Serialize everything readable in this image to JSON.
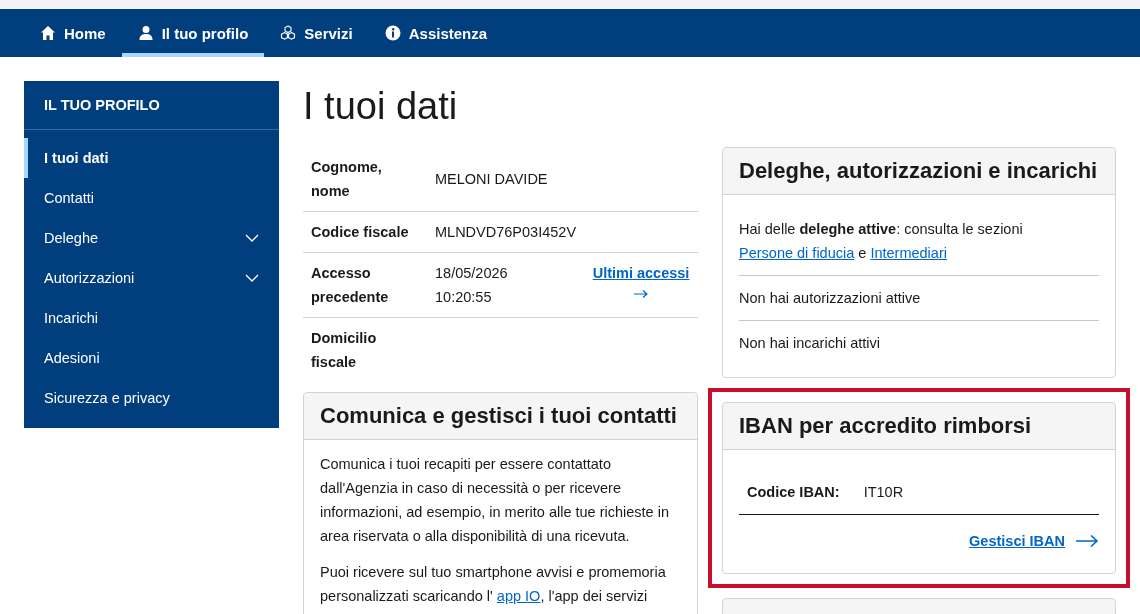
{
  "nav": {
    "items": [
      {
        "label": "Home",
        "selected": false
      },
      {
        "label": "Il tuo profilo",
        "selected": true
      },
      {
        "label": "Servizi",
        "selected": false
      },
      {
        "label": "Assistenza",
        "selected": false
      }
    ]
  },
  "sidebar": {
    "title": "IL TUO PROFILO",
    "items": [
      {
        "label": "I tuoi dati",
        "selected": true,
        "expandable": false
      },
      {
        "label": "Contatti",
        "selected": false,
        "expandable": false
      },
      {
        "label": "Deleghe",
        "selected": false,
        "expandable": true
      },
      {
        "label": "Autorizzazioni",
        "selected": false,
        "expandable": true
      },
      {
        "label": "Incarichi",
        "selected": false,
        "expandable": false
      },
      {
        "label": "Adesioni",
        "selected": false,
        "expandable": false
      },
      {
        "label": "Sicurezza e privacy",
        "selected": false,
        "expandable": false
      }
    ]
  },
  "page_title": "I tuoi dati",
  "data_table": {
    "rows": [
      {
        "label": "Cognome, nome",
        "value": "MELONI DAVIDE"
      },
      {
        "label": "Codice fiscale",
        "value": "MLNDVD76P03I452V"
      },
      {
        "label": "Accesso precedente",
        "value": "18/05/2026 10:20:55",
        "link": "Ultimi accessi"
      },
      {
        "label": "Domicilio fiscale"
      }
    ]
  },
  "contacts_card": {
    "title": "Comunica e gestisci i tuoi contatti",
    "paragraphs": [
      [
        {
          "kind": "text",
          "text": "Comunica i tuoi recapiti per essere contattato dall'Agenzia in caso di necessità o per ricevere informazioni, ad esempio, in merito alle tue richieste in area riservata o alla disponibilità di una ricevuta."
        }
      ],
      [
        {
          "kind": "text",
          "text": "Puoi ricevere sul tuo smartphone avvisi e promemoria personalizzati scaricando l' "
        },
        {
          "kind": "link",
          "text": "app IO"
        },
        {
          "kind": "text",
          "text": ", l'app dei servizi"
        }
      ]
    ]
  },
  "delegations_card": {
    "title": "Deleghe, autorizzazioni e incarichi",
    "sections": [
      [
        {
          "kind": "text",
          "text": "Hai delle **deleghe attive**: consulta le sezioni "
        },
        {
          "kind": "link",
          "text": "Persone di fiducia"
        },
        {
          "kind": "text",
          "text": " e "
        },
        {
          "kind": "link",
          "text": "Intermediari"
        }
      ],
      [
        {
          "kind": "text",
          "text": "Non hai autorizzazioni attive"
        }
      ],
      [
        {
          "kind": "text",
          "text": "Non hai incarichi attivi"
        }
      ]
    ]
  },
  "iban_card": {
    "highlighted": true,
    "title": "IBAN per accredito rimborsi",
    "label": "Codice IBAN:",
    "value": "IT10R",
    "link": "Gestisci IBAN"
  }
}
